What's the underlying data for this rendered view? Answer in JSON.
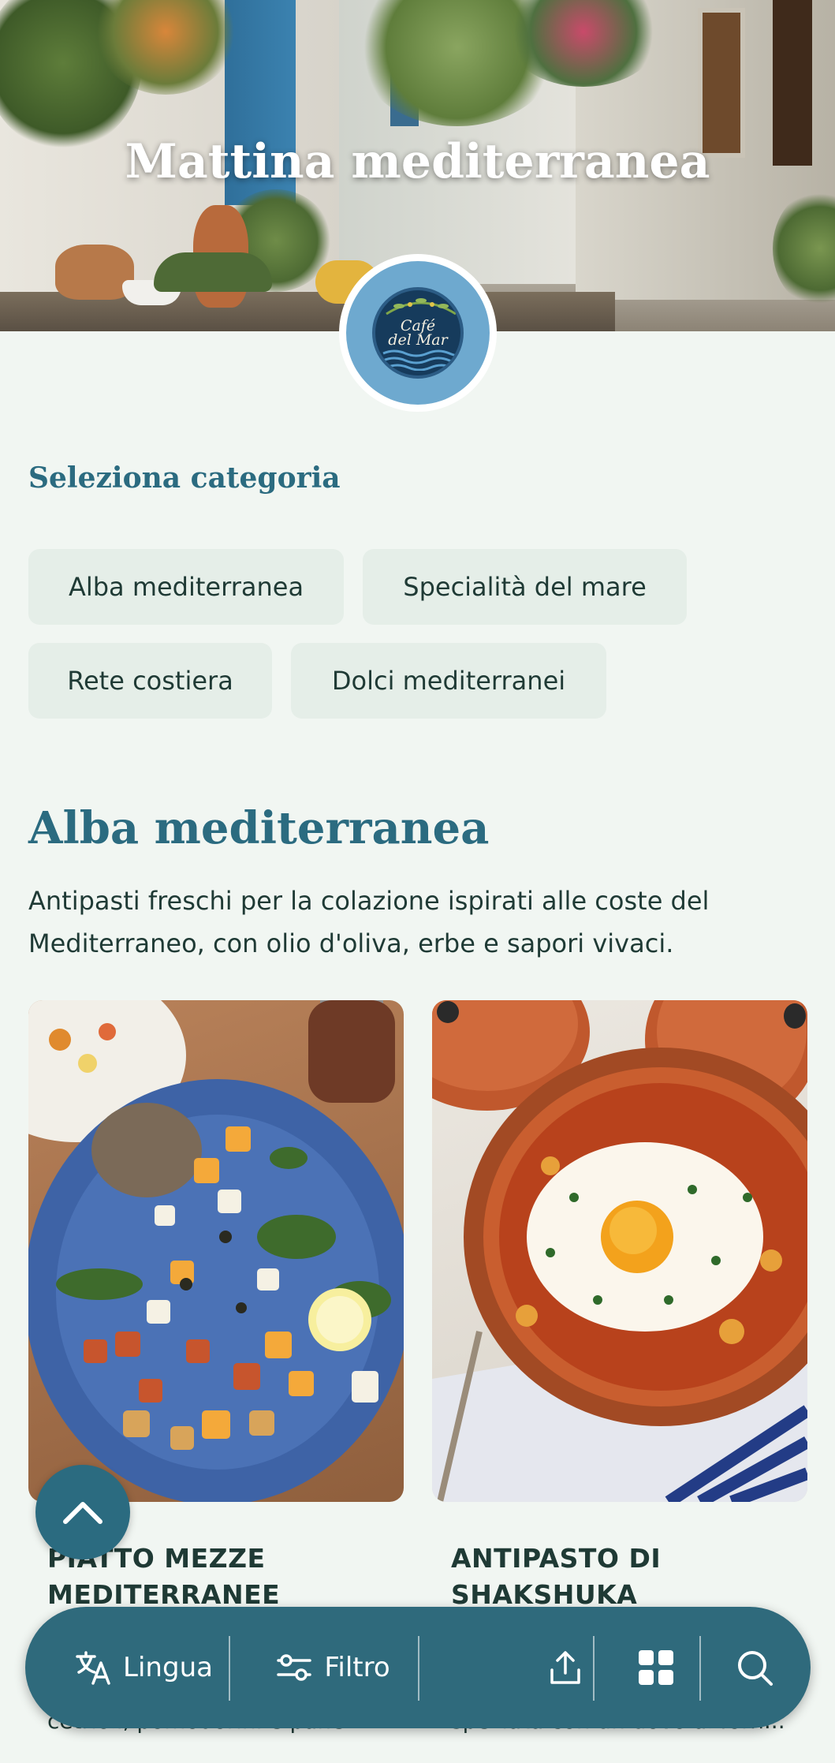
{
  "hero": {
    "title": "Mattina mediterranea"
  },
  "logo": {
    "line1": "Café",
    "line2": "del Mar"
  },
  "categories": {
    "label": "Seleziona categoria",
    "chips": [
      "Alba mediterranea",
      "Specialità del mare",
      "Rete costiera",
      "Dolci mediterranei"
    ]
  },
  "section": {
    "title": "Alba mediterranea",
    "description": "Antipasti freschi per la colazione ispirati alle coste del Mediterraneo, con olio d'oliva, erbe e sapori vivaci."
  },
  "cards": [
    {
      "title": "PIATTO MEZZE MEDITERRANEE",
      "description": "cetrioli, pomodorini e pane..."
    },
    {
      "title": "ANTIPASTO DI SHAKSHUKA",
      "description": "speziata con un uovo al forn..."
    }
  ],
  "bottom_bar": {
    "language_label": "Lingua",
    "filter_label": "Filtro",
    "icons": [
      "translate-icon",
      "filter-sliders-icon",
      "share-icon",
      "grid-icon",
      "search-icon"
    ]
  },
  "colors": {
    "accent": "#2b6b80",
    "bar": "#2f6a7c",
    "chip": "#e5eee8",
    "background": "#f1f6f2"
  }
}
